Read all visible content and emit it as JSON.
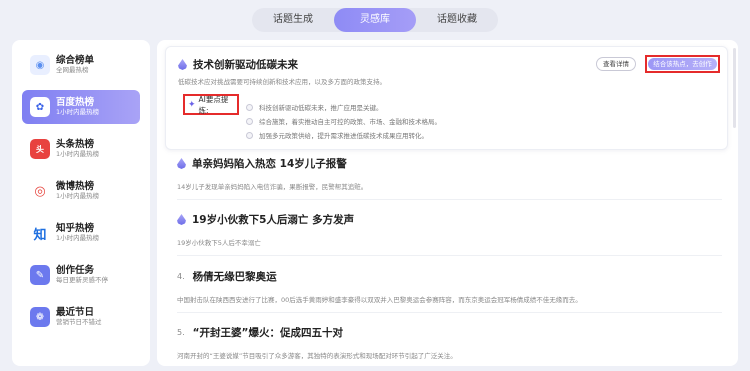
{
  "top_tabs": [
    {
      "label": "话题生成",
      "active": false
    },
    {
      "label": "灵感库",
      "active": true
    },
    {
      "label": "话题收藏",
      "active": false
    }
  ],
  "sidebar": {
    "items": [
      {
        "title": "综合榜单",
        "sub": "全网最热榜",
        "icon": "medal-icon",
        "color": "#5b8ff0",
        "glyph": "◉"
      },
      {
        "title": "百度热榜",
        "sub": "1小时内最热榜",
        "icon": "baidu-paw-icon",
        "color": "#ffffff",
        "glyph": "🐾"
      },
      {
        "title": "头条热榜",
        "sub": "1小时内最热榜",
        "icon": "toutiao-icon",
        "color": "#e8423f",
        "glyph": "头"
      },
      {
        "title": "微博热榜",
        "sub": "1小时内最热榜",
        "icon": "weibo-icon",
        "color": "#e6463f",
        "glyph": "微"
      },
      {
        "title": "知乎热榜",
        "sub": "1小时内最热榜",
        "icon": "zhihu-icon",
        "color": "#1e6fe0",
        "glyph": "知"
      },
      {
        "title": "创作任务",
        "sub": "每日更新灵感不停",
        "icon": "task-icon",
        "color": "#6c79ee",
        "glyph": "✎"
      },
      {
        "title": "最近节日",
        "sub": "营销节日不错过",
        "icon": "calendar-icon",
        "color": "#6c79ee",
        "glyph": "❁"
      }
    ]
  },
  "main": {
    "card1": {
      "title": "技术创新驱动低碳未来",
      "desc": "低碳技术应对挑战需要可持续创新和技术应用，以及多方面的政策支持。",
      "detail_label": "查看详情",
      "create_label": "结合该热点，去创作",
      "ai_label": "AI要点提炼:",
      "points": [
        "科技创新驱动低碳未来，推广应用是关键。",
        "综合施策，着实推动自主可控的政策、市场、金融和技术格局。",
        "加强多元政策供给，提升需求推进低碳技术成果应用转化。"
      ]
    },
    "cards": [
      {
        "num": "",
        "title": "单亲妈妈陷入热恋 14岁儿子报警",
        "desc": "14岁儿子发现单亲妈妈陷入电信诈骗，果断报警，民警帮其追赃。"
      },
      {
        "num": "",
        "title": "19岁小伙救下5人后溺亡 多方发声",
        "desc": "19岁小伙救下5人后不幸溺亡"
      },
      {
        "num": "4.",
        "title": "杨倩无缘巴黎奥运",
        "desc": "中国射击队在陕西西安进行了比赛，00后选手黄雨婷和盛李豪得以双双并入巴黎奥运会参赛阵容，而东京奥运会冠军杨倩成绩不佳无缘而去。"
      },
      {
        "num": "5.",
        "title": "“开封王婆”爆火：促成四五十对",
        "desc": "河南开封的“王婆说媒”节目吸引了众多游客，其独特的表演形式和现场配对环节引起了广泛关注。"
      }
    ]
  }
}
